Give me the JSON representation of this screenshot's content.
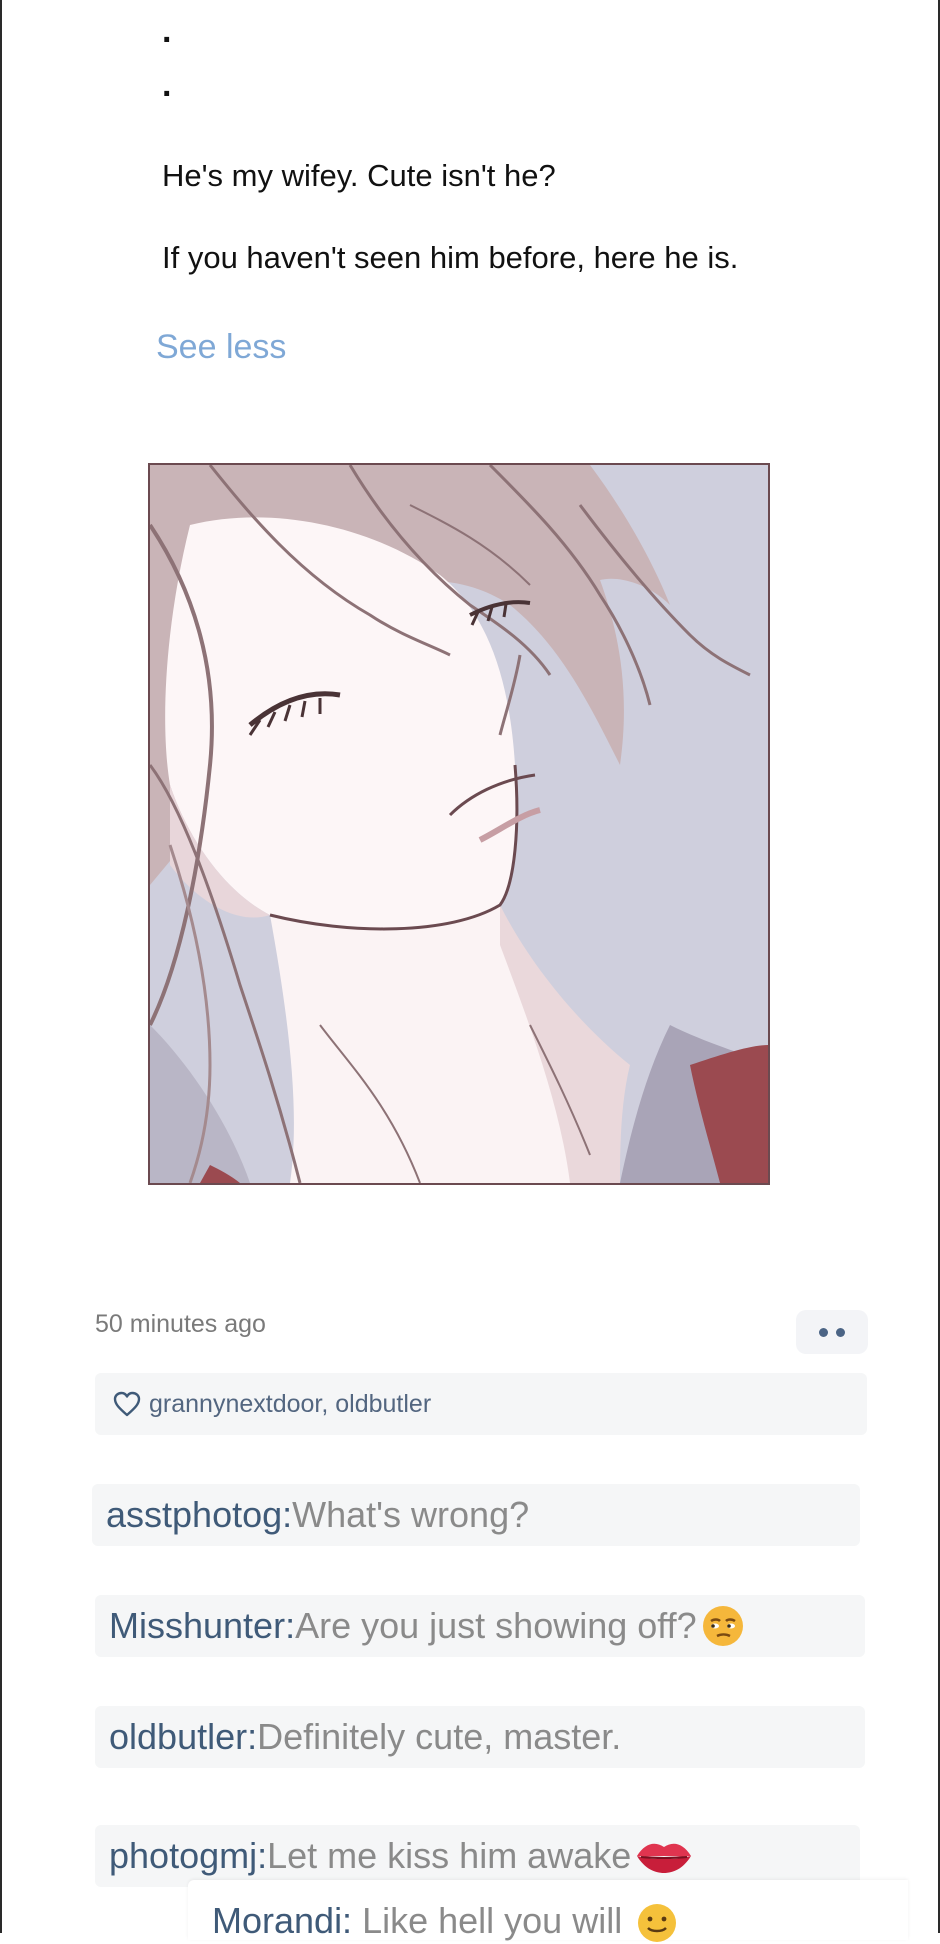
{
  "post": {
    "dots": [
      ".",
      "."
    ],
    "lines": [
      "He's my wifey. Cute isn't he?",
      "If you haven't seen him before, here he is."
    ],
    "see_less": "See less"
  },
  "meta": {
    "timestamp": "50 minutes ago",
    "likes": "grannynextdoor, oldbutler"
  },
  "icons": {
    "more": "more-dots-icon",
    "like": "heart-outline-icon"
  },
  "comments": [
    {
      "author": "asstphotog:",
      "text": " What's wrong?",
      "emoji": ""
    },
    {
      "author": "Misshunter:",
      "text": " Are you just showing off?",
      "emoji": "unamused-face-emoji"
    },
    {
      "author": "oldbutler:",
      "text": " Definitely cute, master.",
      "emoji": ""
    },
    {
      "author": "photogmj:",
      "text": " Let me kiss him awake",
      "emoji": "lips-emoji"
    },
    {
      "author": "Morandi:",
      "text": " Like hell you will",
      "emoji": "slightly-smiling-face-emoji"
    }
  ],
  "colors": {
    "link": "#7fa8d6",
    "author": "#3f5a78",
    "comment_text": "#8a8a8a",
    "comment_bg": "#f5f6f7"
  }
}
